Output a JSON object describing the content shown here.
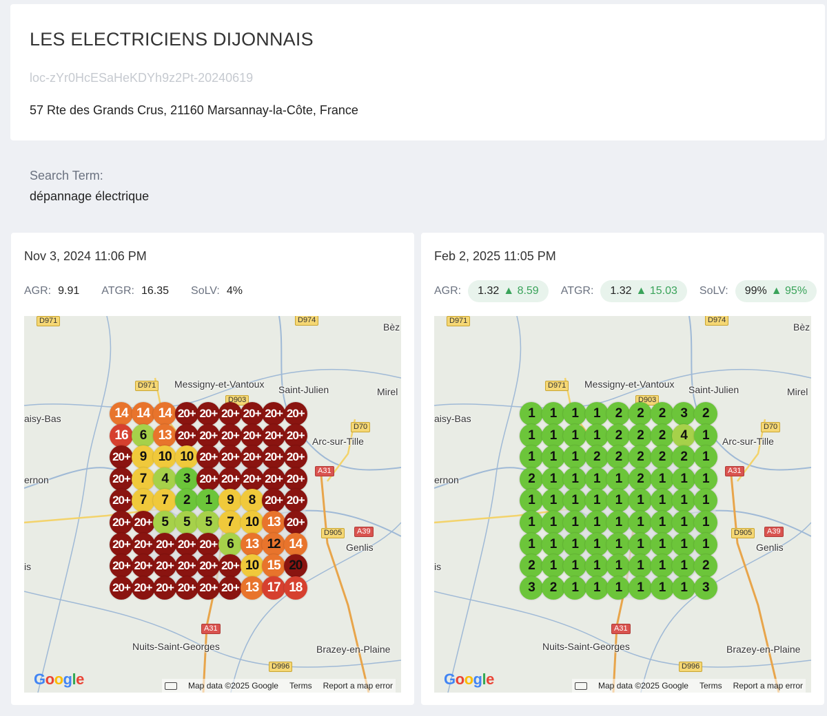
{
  "business": {
    "name": "LES ELECTRICIENS DIJONNAIS",
    "location_id": "loc-zYr0HcESaHeKDYh9z2Pt-20240619",
    "address": "57 Rte des Grands Crus, 21160 Marsannay-la-Côte, France"
  },
  "search": {
    "label": "Search Term:",
    "term": "dépannage électrique"
  },
  "colors": {
    "rank_1_3": "#6cc53a",
    "rank_4_6": "#a6d14a",
    "rank_7_10": "#f0c93b",
    "rank_11_15": "#e8742c",
    "rank_16_19": "#d6402f",
    "rank_20_plus": "#8a1410",
    "delta_positive": "#3aa35a"
  },
  "map": {
    "labels": {
      "d971_top": "D971",
      "d974": "D974",
      "bez": "Bèz",
      "d971_mid": "D971",
      "messigny": "Messigny-et-Vantoux",
      "saint_julien": "Saint-Julien",
      "mirel": "Mirel",
      "d903": "D903",
      "blaisy": "aisy-Bas",
      "d70": "D70",
      "arc": "Arc-sur-Tille",
      "a31_mid": "A31",
      "vernon": "ernon",
      "d905": "D905",
      "a39": "A39",
      "genlis": "Genlis",
      "is": "is",
      "a31_low": "A31",
      "nuits": "Nuits-Saint-Georges",
      "brazey": "Brazey-en-Plaine",
      "d996": "D996"
    },
    "google": "Google",
    "footer": {
      "keyboard_icon": "keyboard-icon",
      "data": "Map data ©2025 Google",
      "terms": "Terms",
      "report": "Report a map error"
    }
  },
  "scans": [
    {
      "date": "Nov 3, 2024 11:06 PM",
      "agr_label": "AGR:",
      "agr_value": "9.91",
      "atgr_label": "ATGR:",
      "atgr_value": "16.35",
      "solv_label": "SoLV:",
      "solv_value": "4%",
      "grid": [
        [
          "14",
          "14",
          "14",
          "20+",
          "20+",
          "20+",
          "20+",
          "20+",
          "20+"
        ],
        [
          "16",
          "6",
          "13",
          "20+",
          "20+",
          "20+",
          "20+",
          "20+",
          "20+"
        ],
        [
          "20+",
          "9",
          "10",
          "10",
          "20+",
          "20+",
          "20+",
          "20+",
          "20+"
        ],
        [
          "20+",
          "7",
          "4",
          "3",
          "20+",
          "20+",
          "20+",
          "20+",
          "20+"
        ],
        [
          "20+",
          "7",
          "7",
          "2",
          "1",
          "9",
          "8",
          "20+",
          "20+"
        ],
        [
          "20+",
          "20+",
          "5",
          "5",
          "5",
          "7",
          "10",
          "13",
          "20+"
        ],
        [
          "20+",
          "20+",
          "20+",
          "20+",
          "20+",
          "6",
          "13",
          "12",
          "14"
        ],
        [
          "20+",
          "20+",
          "20+",
          "20+",
          "20+",
          "20+",
          "10",
          "15",
          "20"
        ],
        [
          "20+",
          "20+",
          "20+",
          "20+",
          "20+",
          "20+",
          "13",
          "17",
          "18"
        ]
      ]
    },
    {
      "date": "Feb 2, 2025 11:05 PM",
      "agr_label": "AGR:",
      "agr_value": "1.32",
      "agr_delta": "8.59",
      "atgr_label": "ATGR:",
      "atgr_value": "1.32",
      "atgr_delta": "15.03",
      "solv_label": "SoLV:",
      "solv_value": "99%",
      "solv_delta": "95%",
      "delta_icon": "triangle-up-icon",
      "grid": [
        [
          "1",
          "1",
          "1",
          "1",
          "2",
          "2",
          "2",
          "3",
          "2"
        ],
        [
          "1",
          "1",
          "1",
          "1",
          "2",
          "2",
          "2",
          "4",
          "1"
        ],
        [
          "1",
          "1",
          "1",
          "2",
          "2",
          "2",
          "2",
          "2",
          "1"
        ],
        [
          "2",
          "1",
          "1",
          "1",
          "1",
          "2",
          "1",
          "1",
          "1"
        ],
        [
          "1",
          "1",
          "1",
          "1",
          "1",
          "1",
          "1",
          "1",
          "1"
        ],
        [
          "1",
          "1",
          "1",
          "1",
          "1",
          "1",
          "1",
          "1",
          "1"
        ],
        [
          "1",
          "1",
          "1",
          "1",
          "1",
          "1",
          "1",
          "1",
          "1"
        ],
        [
          "2",
          "1",
          "1",
          "1",
          "1",
          "1",
          "1",
          "1",
          "2"
        ],
        [
          "3",
          "2",
          "1",
          "1",
          "1",
          "1",
          "1",
          "1",
          "3"
        ]
      ]
    }
  ]
}
